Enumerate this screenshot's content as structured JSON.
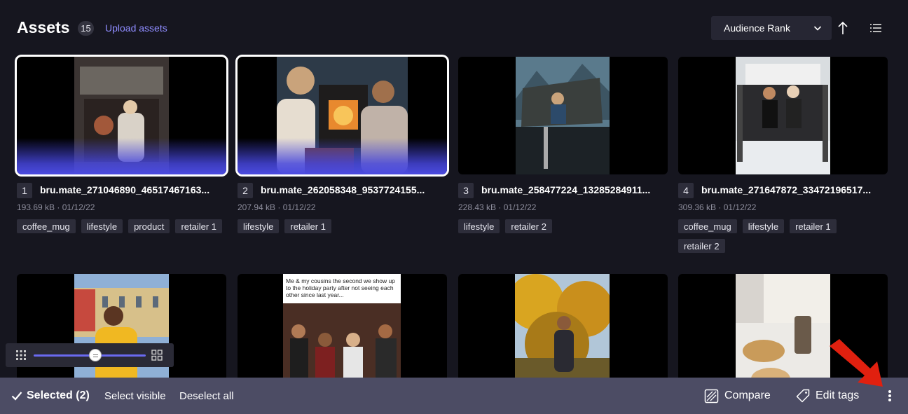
{
  "header": {
    "title": "Assets",
    "count": "15",
    "upload_label": "Upload assets",
    "sort_label": "Audience Rank"
  },
  "assets": [
    {
      "index": "1",
      "name": "bru.mate_271046890_46517467163...",
      "size": "193.69 kB",
      "date": "01/12/22",
      "sep": "·",
      "tags": [
        "coffee_mug",
        "lifestyle",
        "product",
        "retailer 1"
      ],
      "selected": true
    },
    {
      "index": "2",
      "name": "bru.mate_262058348_9537724155...",
      "size": "207.94 kB",
      "date": "01/12/22",
      "sep": "·",
      "tags": [
        "lifestyle",
        "retailer 1"
      ],
      "selected": true
    },
    {
      "index": "3",
      "name": "bru.mate_258477224_13285284911...",
      "size": "228.43 kB",
      "date": "01/12/22",
      "sep": "·",
      "tags": [
        "lifestyle",
        "retailer 2"
      ],
      "selected": false
    },
    {
      "index": "4",
      "name": "bru.mate_271647872_33472196517...",
      "size": "309.36 kB",
      "date": "01/12/22",
      "sep": "·",
      "tags": [
        "coffee_mug",
        "lifestyle",
        "retailer 1",
        "retailer 2"
      ],
      "selected": false
    }
  ],
  "second_row": {
    "meme_caption": "Me & my cousins the second we show up to the holiday party after not seeing each other since last year..."
  },
  "zoom": {
    "level": 0.55
  },
  "bottombar": {
    "selected_label": "Selected (2)",
    "select_visible_label": "Select visible",
    "deselect_all_label": "Deselect all",
    "compare_label": "Compare",
    "edit_tags_label": "Edit tags"
  },
  "colors": {
    "accent": "#6a6af0",
    "link": "#8f8cff",
    "bottombar": "#4c4c64",
    "annotation_arrow": "#e0200f"
  }
}
